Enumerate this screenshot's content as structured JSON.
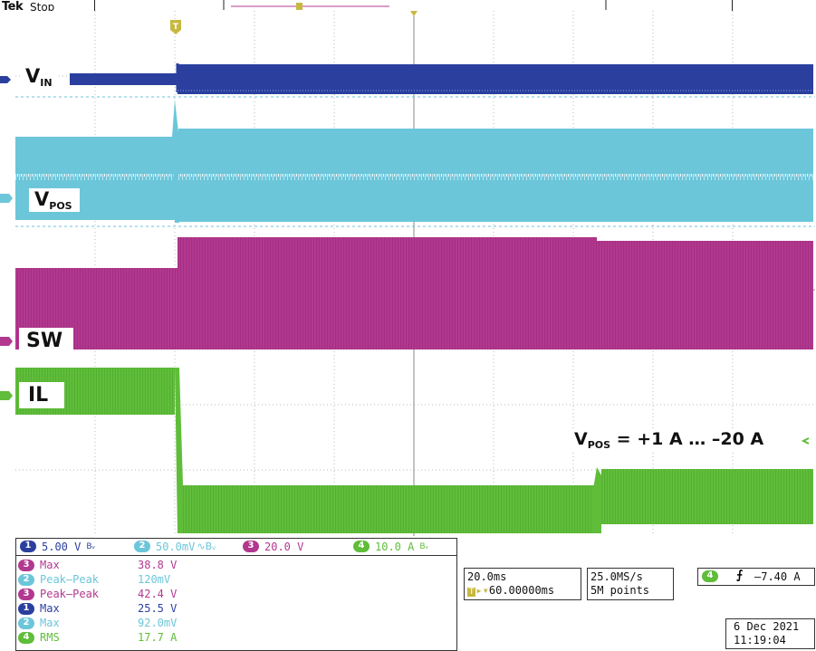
{
  "header": {
    "brand": "Tek",
    "status": "Stop",
    "trigger_marker": "T"
  },
  "colors": {
    "ch1": "#2a3f9e",
    "ch2": "#6cc6da",
    "ch3": "#b2388f",
    "ch4": "#5fbd3a",
    "grid": "#b8b8b8"
  },
  "waveform_labels": {
    "vin": {
      "main": "V",
      "sub": "IN"
    },
    "vpos": {
      "main": "V",
      "sub": "POS"
    },
    "sw": {
      "main": "SW"
    },
    "il": {
      "main": "IL"
    }
  },
  "channel_markers": [
    "1",
    "2",
    "3",
    "4"
  ],
  "annotation": {
    "v": "V",
    "sub": "POS",
    "rest": " = +1 A … –20 A"
  },
  "channels": [
    {
      "num": "1",
      "scale": "5.00 V",
      "color": "#2a3f9e",
      "icon": "bandwidth-limit-icon"
    },
    {
      "num": "2",
      "scale": "50.0mV",
      "color": "#6cc6da",
      "icon": "ac-coupling-icon"
    },
    {
      "num": "3",
      "scale": "20.0 V",
      "color": "#b2388f",
      "icon": ""
    },
    {
      "num": "4",
      "scale": "10.0 A",
      "color": "#5fbd3a",
      "icon": "bandwidth-limit-icon"
    }
  ],
  "measurements": [
    {
      "ch": "3",
      "name": "Max",
      "value": "38.8 V"
    },
    {
      "ch": "2",
      "name": "Peak–Peak",
      "value": "120mV"
    },
    {
      "ch": "3",
      "name": "Peak–Peak",
      "value": "42.4 V"
    },
    {
      "ch": "1",
      "name": "Max",
      "value": "25.5 V"
    },
    {
      "ch": "2",
      "name": "Max",
      "value": "92.0mV"
    },
    {
      "ch": "4",
      "name": "RMS",
      "value": "17.7 A"
    }
  ],
  "timebase": {
    "scale": "20.0ms",
    "position": "60.00000ms"
  },
  "acquisition": {
    "rate": "25.0MS/s",
    "points": "5M points"
  },
  "trigger": {
    "ch": "4",
    "level": "–7.40 A"
  },
  "datetime": {
    "date": "6 Dec  2021",
    "time": "11:19:04"
  }
}
